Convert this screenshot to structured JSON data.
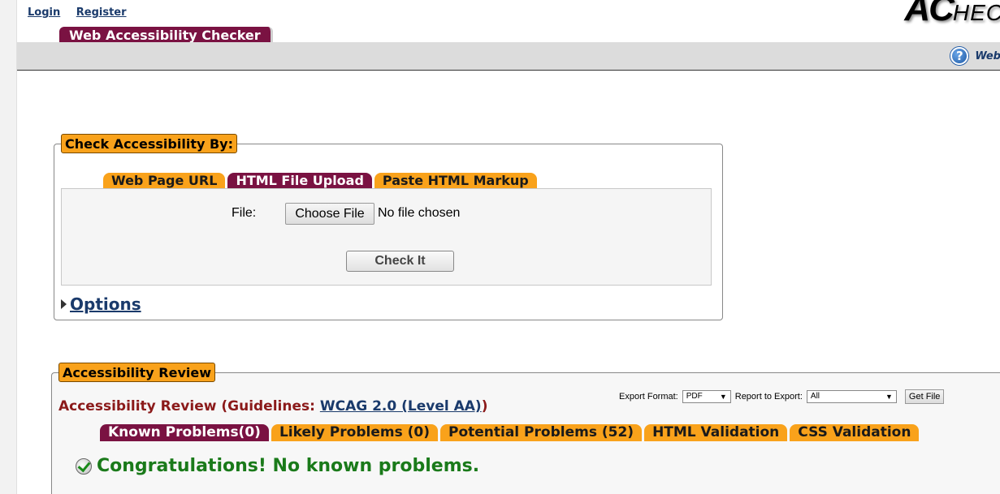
{
  "top_links": {
    "login": "Login",
    "register": "Register"
  },
  "logo": {
    "big": "AC",
    "small": "HEC"
  },
  "site_tab": "Web Accessibility Checker",
  "help": {
    "text": "Web"
  },
  "check_section": {
    "legend": "Check Accessibility By:",
    "tabs": [
      {
        "label": "Web Page URL",
        "active": false
      },
      {
        "label": "HTML File Upload",
        "active": true
      },
      {
        "label": "Paste HTML Markup",
        "active": false
      }
    ],
    "file_label": "File:",
    "choose_file": "Choose File",
    "no_file": "No file chosen",
    "check_button": "Check It",
    "options": "Options"
  },
  "review_section": {
    "legend": "Accessibility Review",
    "title_prefix": "Accessibility Review (Guidelines: ",
    "guideline_link": "WCAG 2.0 (Level AA)",
    "title_suffix": ")",
    "export": {
      "format_label": "Export Format:",
      "format_value": "PDF",
      "report_label": "Report to Export:",
      "report_value": "All",
      "get_file": "Get File"
    },
    "tabs": [
      {
        "label": "Known Problems(0)",
        "active": true
      },
      {
        "label": "Likely Problems (0)",
        "active": false
      },
      {
        "label": "Potential Problems (52)",
        "active": false
      },
      {
        "label": "HTML Validation",
        "active": false
      },
      {
        "label": "CSS Validation",
        "active": false
      }
    ],
    "congrats": "Congratulations! No known problems."
  },
  "colors": {
    "accent_orange": "#f9a21b",
    "accent_maroon": "#7a1242",
    "link_blue": "#1a3a6b",
    "success_green": "#1a7a1a"
  }
}
